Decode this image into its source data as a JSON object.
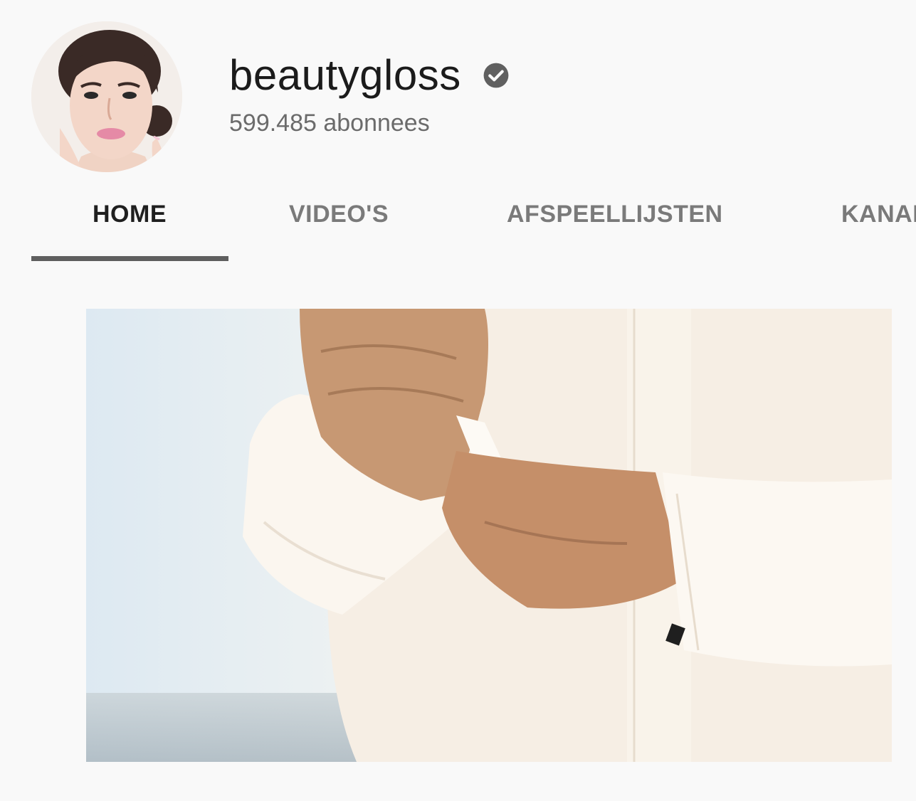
{
  "channel": {
    "name": "beautygloss",
    "verified_icon": "verified-check-icon",
    "subscribers": "599.485 abonnees",
    "avatar": "channel-avatar"
  },
  "tabs": [
    {
      "label": "HOME",
      "active": true
    },
    {
      "label": "VIDEO'S",
      "active": false
    },
    {
      "label": "AFSPEELLIJSTEN",
      "active": false
    },
    {
      "label": "KANAL",
      "active": false
    }
  ],
  "featured_video": {
    "thumbnail": "featured-video-thumbnail"
  },
  "colors": {
    "background": "#f9f9f9",
    "text_primary": "#1b1b1b",
    "text_secondary": "#6b6b6b",
    "tab_inactive": "#7a7a7a",
    "tab_indicator": "#5f5f5f"
  }
}
